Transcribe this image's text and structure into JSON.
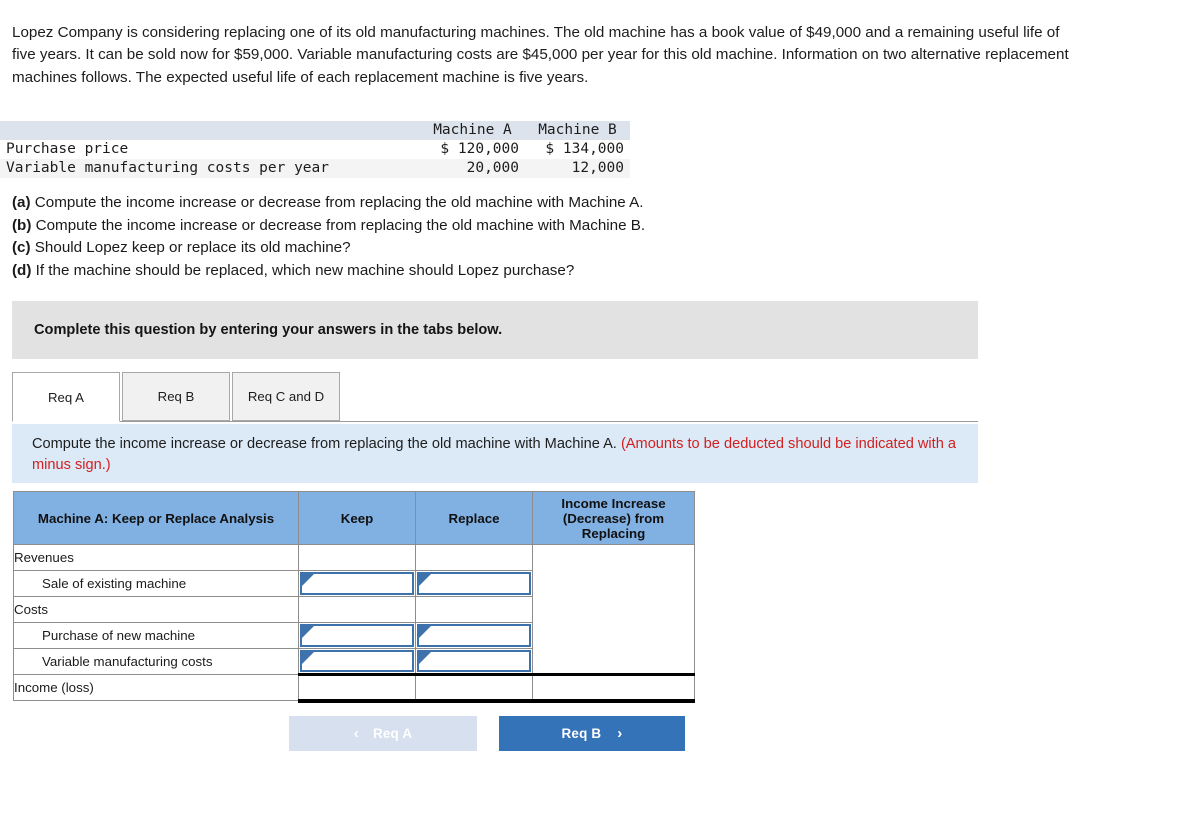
{
  "intro": "Lopez Company is considering replacing one of its old manufacturing machines. The old machine has a book value of $49,000 and a remaining useful life of five years. It can be sold now for $59,000. Variable manufacturing costs are $45,000 per year for this old machine. Information on two alternative replacement machines follows. The expected useful life of each replacement machine is five years.",
  "data_table": {
    "headers": [
      "",
      "Machine A",
      "Machine B"
    ],
    "rows": [
      {
        "label": "Purchase price",
        "machine_a": "$ 120,000",
        "machine_b": "$ 134,000"
      },
      {
        "label": "Variable manufacturing costs per year",
        "machine_a": "20,000",
        "machine_b": "12,000"
      }
    ]
  },
  "questions": [
    {
      "label": "(a)",
      "text": "Compute the income increase or decrease from replacing the old machine with Machine A."
    },
    {
      "label": "(b)",
      "text": "Compute the income increase or decrease from replacing the old machine with Machine B."
    },
    {
      "label": "(c)",
      "text": "Should Lopez keep or replace its old machine?"
    },
    {
      "label": "(d)",
      "text": "If the machine should be replaced, which new machine should Lopez purchase?"
    }
  ],
  "gray_band": {
    "text": "Complete this question by entering your answers in the tabs below."
  },
  "tabs": [
    {
      "label": "Req A",
      "active": true
    },
    {
      "label": "Req B",
      "active": false
    },
    {
      "label": "Req C and D",
      "active": false
    }
  ],
  "req_panel": {
    "text": "Compute the income increase or decrease from replacing the old machine with Machine A.",
    "hint": "(Amounts to be deducted should be indicated with a minus sign.)"
  },
  "answer_table": {
    "headers": {
      "label": "Machine A: Keep or Replace Analysis",
      "keep": "Keep",
      "replace": "Replace",
      "income_line1": "Income Increase",
      "income_line2": "(Decrease) from",
      "income_line3": "Replacing"
    },
    "rows": [
      {
        "label": "Revenues",
        "indent": false,
        "input": false
      },
      {
        "label": "Sale of existing machine",
        "indent": true,
        "input": true
      },
      {
        "label": "Costs",
        "indent": false,
        "input": false
      },
      {
        "label": "Purchase of new machine",
        "indent": true,
        "input": true
      },
      {
        "label": "Variable manufacturing costs",
        "indent": true,
        "input": true
      }
    ],
    "total_row": {
      "label": "Income (loss)",
      "keep": "",
      "replace": "",
      "income": ""
    }
  },
  "nav": {
    "prev_label": "Req A",
    "prev_chevron": "‹",
    "next_label": "Req B",
    "next_chevron": "›"
  },
  "colors": {
    "header_blue": "#81b1e3",
    "panel_blue": "#dceaf7",
    "button_blue": "#3573b9",
    "button_disabled": "#d6e0ee",
    "hint_red": "#d21f1f",
    "gray_band": "#e2e2e2",
    "input_border": "#3e72ad"
  }
}
